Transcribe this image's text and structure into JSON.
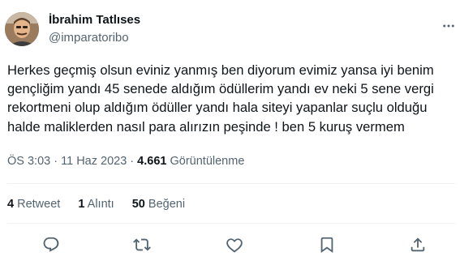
{
  "author": {
    "name": "İbrahim Tatlıses",
    "handle": "@imparatoribo"
  },
  "tweet": {
    "text": "Herkes geçmiş olsun eviniz yanmış ben diyorum  evimiz yansa iyi benim\ngençliğim yandı 45 senede aldığım ödüllerim yandı ev neki 5 sene vergi\nrekortmeni olup aldığım ödüller yandı hala siteyi yapanlar suçlu olduğu\nhalde maliklerden nasıl para alırızın peşinde ! ben 5 kuruş vermem"
  },
  "meta": {
    "time": "ÖS 3:03",
    "separator": "·",
    "date": "11 Haz 2023",
    "views_count": "4.661",
    "views_label": "Görüntülenme"
  },
  "stats": {
    "retweets_count": "4",
    "retweets_label": "Retweet",
    "quotes_count": "1",
    "quotes_label": "Alıntı",
    "likes_count": "50",
    "likes_label": "Beğeni"
  },
  "icons": {
    "more": "more-icon",
    "reply": "reply-icon",
    "retweet": "retweet-icon",
    "like": "like-icon",
    "bookmark": "bookmark-icon",
    "share": "share-icon"
  },
  "colors": {
    "text": "#0f1419",
    "secondary": "#536471",
    "divider": "#eff3f4"
  }
}
